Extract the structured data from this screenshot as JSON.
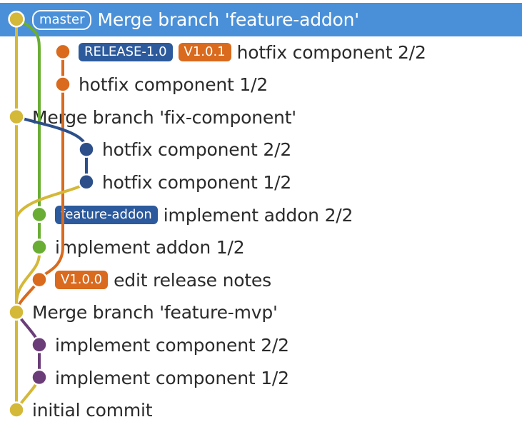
{
  "colors": {
    "selection": "#4a90d9",
    "lane_master": "#d4b838",
    "lane_feature_addon": "#6aad34",
    "lane_release": "#d96a1e",
    "lane_fix_component": "#2c4f8a",
    "lane_feature_mvp": "#6b3d78",
    "branch_badge": "#2c5a9c",
    "tag_badge": "#d96a1e"
  },
  "commits": [
    {
      "message": "Merge branch 'feature-addon'",
      "refs": [
        {
          "kind": "head",
          "label": "master"
        }
      ],
      "lane": 0,
      "color": "#d4b838",
      "selected": true
    },
    {
      "message": "hotfix component 2/2",
      "refs": [
        {
          "kind": "branch",
          "label": "RELEASE-1.0"
        },
        {
          "kind": "tag",
          "label": "V1.0.1"
        }
      ],
      "lane": 2,
      "color": "#d96a1e"
    },
    {
      "message": "hotfix component 1/2",
      "refs": [],
      "lane": 2,
      "color": "#d96a1e"
    },
    {
      "message": "Merge branch 'fix-component'",
      "refs": [],
      "lane": 0,
      "color": "#d4b838"
    },
    {
      "message": "hotfix component 2/2",
      "refs": [],
      "lane": 3,
      "color": "#2c4f8a"
    },
    {
      "message": "hotfix component 1/2",
      "refs": [],
      "lane": 3,
      "color": "#2c4f8a"
    },
    {
      "message": "implement addon 2/2",
      "refs": [
        {
          "kind": "branch",
          "label": "feature-addon"
        }
      ],
      "lane": 1,
      "color": "#6aad34"
    },
    {
      "message": "implement addon 1/2",
      "refs": [],
      "lane": 1,
      "color": "#6aad34"
    },
    {
      "message": "edit release notes",
      "refs": [
        {
          "kind": "tag",
          "label": "V1.0.0"
        }
      ],
      "lane": 1,
      "color": "#d96a1e"
    },
    {
      "message": "Merge branch 'feature-mvp'",
      "refs": [],
      "lane": 0,
      "color": "#d4b838"
    },
    {
      "message": "implement component 2/2",
      "refs": [],
      "lane": 1,
      "color": "#6b3d78"
    },
    {
      "message": "implement component 1/2",
      "refs": [],
      "lane": 1,
      "color": "#6b3d78"
    },
    {
      "message": "initial commit",
      "refs": [],
      "lane": 0,
      "color": "#d4b838"
    }
  ]
}
